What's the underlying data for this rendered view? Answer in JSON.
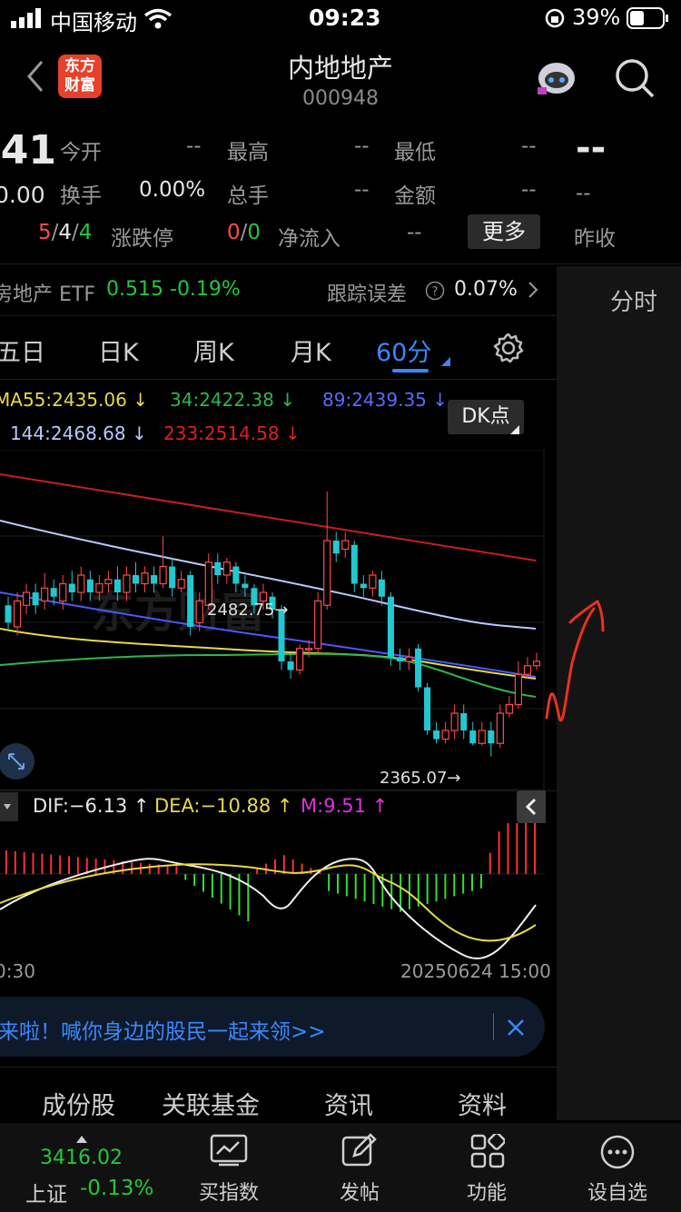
{
  "status_bar": {
    "carrier": "中国移动",
    "time": "09:23",
    "battery": "39%"
  },
  "nav": {
    "title": "内地地产",
    "code": "000948",
    "logo_line1": "东方",
    "logo_line2": "财富"
  },
  "quote": {
    "price_partial": ".41",
    "change_partial": "0.00",
    "open_label": "今开",
    "open_val": "--",
    "high_label": "最高",
    "high_val": "--",
    "low_label": "最低",
    "low_val": "--",
    "turnover_label": "换手",
    "turnover_val": "0.00%",
    "volume_label": "总手",
    "volume_val": "--",
    "amount_label": "金额",
    "amount_val": "--",
    "updown_a": "5",
    "updown_b": "4",
    "updown_c": "4",
    "limit_label": "涨跌停",
    "limit_a": "0",
    "limit_b": "0",
    "netflow_label": "净流入",
    "netflow_val": "--",
    "more_btn": "更多",
    "side_big": "--",
    "side_small": "--",
    "side_prev": "昨收"
  },
  "etf": {
    "name": "房地产 ETF",
    "price": "0.515",
    "change": "-0.19%",
    "err_label": "跟踪误差",
    "err_val": "0.07%"
  },
  "side_tab": "分时",
  "period_tabs": [
    "五日",
    "日K",
    "周K",
    "月K",
    "60分"
  ],
  "ma": {
    "ma55": "MA55:2435.06 ↓",
    "ma34": "34:2422.38 ↓",
    "ma89": "89:2439.35 ↓",
    "ma144": "144:2468.68 ↓",
    "ma233": "233:2514.58 ↓",
    "dk_btn": "DK点"
  },
  "chart_labels": {
    "high_mark": "2482.75→",
    "low_mark": "2365.07→"
  },
  "macd": {
    "dif": "DIF:−6.13 ↑",
    "dea": "DEA:−10.88 ↑",
    "m": "M:9.51 ↑"
  },
  "time_axis": {
    "left": "0:30",
    "right": "20250624 15:00"
  },
  "banner": {
    "text": "来啦！喊你身边的股民一起来领>>"
  },
  "bottom_tabs": [
    "成份股",
    "关联基金",
    "资讯",
    "资料"
  ],
  "tabbar": {
    "index_val": "3416.02",
    "index_name": "上证",
    "index_change": "-0.13%",
    "items": [
      "买指数",
      "发帖",
      "功能",
      "设自选"
    ]
  },
  "colors": {
    "up": "#ff4a4a",
    "down": "#22c8d0",
    "ma55": "#e8d84a",
    "ma34": "#2db84a",
    "ma89": "#4a5aff",
    "ma144": "#b8c8ff",
    "ma233": "#e02020",
    "accent": "#3a88ff"
  },
  "chart_data": {
    "type": "candlestick",
    "period": "60分",
    "annotations": [
      {
        "label": "2482.75",
        "kind": "high"
      },
      {
        "label": "2365.07",
        "kind": "low"
      }
    ],
    "moving_averages": [
      {
        "name": "MA55",
        "value": 2435.06
      },
      {
        "name": "MA34",
        "value": 2422.38
      },
      {
        "name": "MA89",
        "value": 2439.35
      },
      {
        "name": "MA144",
        "value": 2468.68
      },
      {
        "name": "MA233",
        "value": 2514.58
      }
    ],
    "candles": [
      {
        "o": 2430,
        "c": 2422,
        "h": 2434,
        "l": 2418
      },
      {
        "o": 2420,
        "c": 2432,
        "h": 2436,
        "l": 2416
      },
      {
        "o": 2430,
        "c": 2436,
        "h": 2440,
        "l": 2426
      },
      {
        "o": 2436,
        "c": 2430,
        "h": 2440,
        "l": 2426
      },
      {
        "o": 2432,
        "c": 2438,
        "h": 2445,
        "l": 2428
      },
      {
        "o": 2438,
        "c": 2434,
        "h": 2442,
        "l": 2430
      },
      {
        "o": 2432,
        "c": 2440,
        "h": 2444,
        "l": 2428
      },
      {
        "o": 2440,
        "c": 2436,
        "h": 2446,
        "l": 2432
      },
      {
        "o": 2436,
        "c": 2444,
        "h": 2448,
        "l": 2432
      },
      {
        "o": 2442,
        "c": 2436,
        "h": 2446,
        "l": 2432
      },
      {
        "o": 2436,
        "c": 2440,
        "h": 2444,
        "l": 2432
      },
      {
        "o": 2440,
        "c": 2442,
        "h": 2446,
        "l": 2436
      },
      {
        "o": 2442,
        "c": 2436,
        "h": 2448,
        "l": 2432
      },
      {
        "o": 2436,
        "c": 2444,
        "h": 2448,
        "l": 2432
      },
      {
        "o": 2444,
        "c": 2440,
        "h": 2450,
        "l": 2436
      },
      {
        "o": 2440,
        "c": 2445,
        "h": 2448,
        "l": 2436
      },
      {
        "o": 2444,
        "c": 2440,
        "h": 2448,
        "l": 2436
      },
      {
        "o": 2440,
        "c": 2448,
        "h": 2462,
        "l": 2438
      },
      {
        "o": 2448,
        "c": 2438,
        "h": 2452,
        "l": 2434
      },
      {
        "o": 2438,
        "c": 2442,
        "h": 2446,
        "l": 2436
      },
      {
        "o": 2444,
        "c": 2420,
        "h": 2446,
        "l": 2416
      },
      {
        "o": 2422,
        "c": 2432,
        "h": 2436,
        "l": 2418
      },
      {
        "o": 2430,
        "c": 2450,
        "h": 2454,
        "l": 2428
      },
      {
        "o": 2450,
        "c": 2444,
        "h": 2454,
        "l": 2440
      },
      {
        "o": 2444,
        "c": 2450,
        "h": 2452,
        "l": 2440
      },
      {
        "o": 2448,
        "c": 2440,
        "h": 2450,
        "l": 2436
      },
      {
        "o": 2440,
        "c": 2438,
        "h": 2444,
        "l": 2434
      },
      {
        "o": 2438,
        "c": 2430,
        "h": 2440,
        "l": 2426
      },
      {
        "o": 2432,
        "c": 2436,
        "h": 2440,
        "l": 2428
      },
      {
        "o": 2434,
        "c": 2428,
        "h": 2436,
        "l": 2424
      },
      {
        "o": 2428,
        "c": 2404,
        "h": 2430,
        "l": 2400
      },
      {
        "o": 2404,
        "c": 2400,
        "h": 2408,
        "l": 2396
      },
      {
        "o": 2400,
        "c": 2410,
        "h": 2412,
        "l": 2398
      },
      {
        "o": 2410,
        "c": 2410,
        "h": 2414,
        "l": 2406
      },
      {
        "o": 2410,
        "c": 2432,
        "h": 2436,
        "l": 2408
      },
      {
        "o": 2430,
        "c": 2460,
        "h": 2482.75,
        "l": 2428
      },
      {
        "o": 2460,
        "c": 2454,
        "h": 2464,
        "l": 2450
      },
      {
        "o": 2456,
        "c": 2460,
        "h": 2464,
        "l": 2452
      },
      {
        "o": 2458,
        "c": 2440,
        "h": 2460,
        "l": 2436
      },
      {
        "o": 2440,
        "c": 2438,
        "h": 2444,
        "l": 2434
      },
      {
        "o": 2438,
        "c": 2444,
        "h": 2446,
        "l": 2434
      },
      {
        "o": 2442,
        "c": 2434,
        "h": 2446,
        "l": 2430
      },
      {
        "o": 2434,
        "c": 2406,
        "h": 2436,
        "l": 2402
      },
      {
        "o": 2406,
        "c": 2404,
        "h": 2410,
        "l": 2400
      },
      {
        "o": 2404,
        "c": 2406,
        "h": 2410,
        "l": 2400
      },
      {
        "o": 2410,
        "c": 2392,
        "h": 2412,
        "l": 2390
      },
      {
        "o": 2392,
        "c": 2372,
        "h": 2394,
        "l": 2370
      },
      {
        "o": 2372,
        "c": 2368,
        "h": 2376,
        "l": 2366
      },
      {
        "o": 2368,
        "c": 2372,
        "h": 2376,
        "l": 2366
      },
      {
        "o": 2372,
        "c": 2380,
        "h": 2384,
        "l": 2368
      },
      {
        "o": 2380,
        "c": 2372,
        "h": 2384,
        "l": 2368
      },
      {
        "o": 2372,
        "c": 2366,
        "h": 2376,
        "l": 2365.07
      },
      {
        "o": 2366,
        "c": 2372,
        "h": 2376,
        "l": 2365.07
      },
      {
        "o": 2372,
        "c": 2366,
        "h": 2376,
        "l": 2360
      },
      {
        "o": 2366,
        "c": 2380,
        "h": 2384,
        "l": 2364
      },
      {
        "o": 2380,
        "c": 2384,
        "h": 2388,
        "l": 2378
      },
      {
        "o": 2384,
        "c": 2398,
        "h": 2404,
        "l": 2382
      },
      {
        "o": 2398,
        "c": 2402,
        "h": 2406,
        "l": 2396
      },
      {
        "o": 2402,
        "c": 2404,
        "h": 2408,
        "l": 2400
      }
    ]
  }
}
